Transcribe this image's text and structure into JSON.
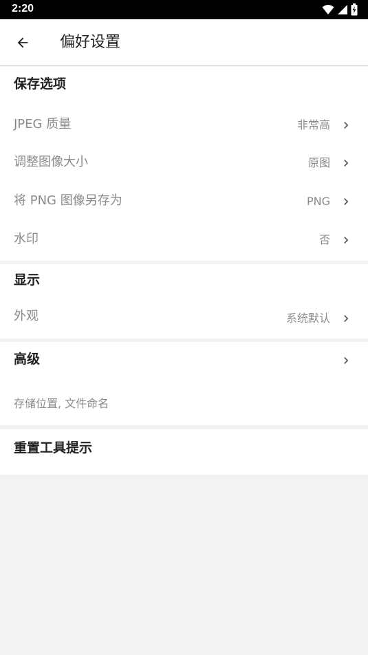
{
  "status_bar": {
    "time": "2:20"
  },
  "app_bar": {
    "title": "偏好设置"
  },
  "save_options": {
    "header": "保存选项",
    "items": [
      {
        "label": "JPEG 质量",
        "value": "非常高"
      },
      {
        "label": "调整图像大小",
        "value": "原图"
      },
      {
        "label": "将 PNG 图像另存为",
        "value": "PNG"
      },
      {
        "label": "水印",
        "value": "否"
      }
    ]
  },
  "display": {
    "header": "显示",
    "items": [
      {
        "label": "外观",
        "value": "系统默认"
      }
    ]
  },
  "advanced": {
    "header": "高级",
    "summary": "存储位置, 文件命名"
  },
  "reset": {
    "header": "重置工具提示"
  },
  "colors": {
    "background": "#f2f2f2",
    "surface": "#ffffff",
    "primary_text": "#222222",
    "secondary_text": "#8a8a8a",
    "status_bar": "#000000"
  }
}
